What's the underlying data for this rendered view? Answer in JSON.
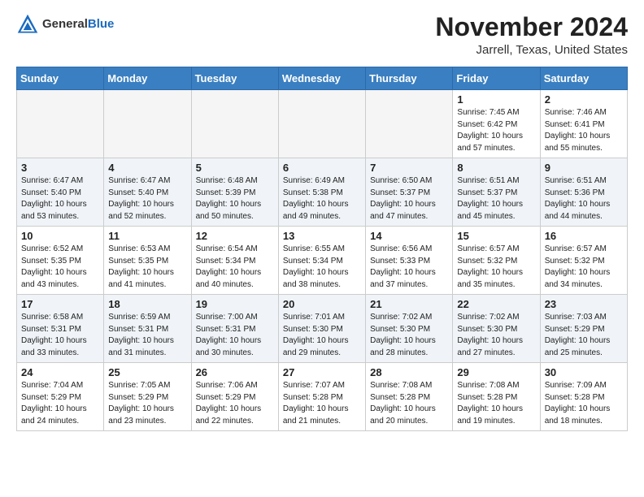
{
  "header": {
    "logo_general": "General",
    "logo_blue": "Blue",
    "month_title": "November 2024",
    "location": "Jarrell, Texas, United States"
  },
  "days_of_week": [
    "Sunday",
    "Monday",
    "Tuesday",
    "Wednesday",
    "Thursday",
    "Friday",
    "Saturday"
  ],
  "weeks": [
    [
      {
        "day": "",
        "info": ""
      },
      {
        "day": "",
        "info": ""
      },
      {
        "day": "",
        "info": ""
      },
      {
        "day": "",
        "info": ""
      },
      {
        "day": "",
        "info": ""
      },
      {
        "day": "1",
        "info": "Sunrise: 7:45 AM\nSunset: 6:42 PM\nDaylight: 10 hours\nand 57 minutes."
      },
      {
        "day": "2",
        "info": "Sunrise: 7:46 AM\nSunset: 6:41 PM\nDaylight: 10 hours\nand 55 minutes."
      }
    ],
    [
      {
        "day": "3",
        "info": "Sunrise: 6:47 AM\nSunset: 5:40 PM\nDaylight: 10 hours\nand 53 minutes."
      },
      {
        "day": "4",
        "info": "Sunrise: 6:47 AM\nSunset: 5:40 PM\nDaylight: 10 hours\nand 52 minutes."
      },
      {
        "day": "5",
        "info": "Sunrise: 6:48 AM\nSunset: 5:39 PM\nDaylight: 10 hours\nand 50 minutes."
      },
      {
        "day": "6",
        "info": "Sunrise: 6:49 AM\nSunset: 5:38 PM\nDaylight: 10 hours\nand 49 minutes."
      },
      {
        "day": "7",
        "info": "Sunrise: 6:50 AM\nSunset: 5:37 PM\nDaylight: 10 hours\nand 47 minutes."
      },
      {
        "day": "8",
        "info": "Sunrise: 6:51 AM\nSunset: 5:37 PM\nDaylight: 10 hours\nand 45 minutes."
      },
      {
        "day": "9",
        "info": "Sunrise: 6:51 AM\nSunset: 5:36 PM\nDaylight: 10 hours\nand 44 minutes."
      }
    ],
    [
      {
        "day": "10",
        "info": "Sunrise: 6:52 AM\nSunset: 5:35 PM\nDaylight: 10 hours\nand 43 minutes."
      },
      {
        "day": "11",
        "info": "Sunrise: 6:53 AM\nSunset: 5:35 PM\nDaylight: 10 hours\nand 41 minutes."
      },
      {
        "day": "12",
        "info": "Sunrise: 6:54 AM\nSunset: 5:34 PM\nDaylight: 10 hours\nand 40 minutes."
      },
      {
        "day": "13",
        "info": "Sunrise: 6:55 AM\nSunset: 5:34 PM\nDaylight: 10 hours\nand 38 minutes."
      },
      {
        "day": "14",
        "info": "Sunrise: 6:56 AM\nSunset: 5:33 PM\nDaylight: 10 hours\nand 37 minutes."
      },
      {
        "day": "15",
        "info": "Sunrise: 6:57 AM\nSunset: 5:32 PM\nDaylight: 10 hours\nand 35 minutes."
      },
      {
        "day": "16",
        "info": "Sunrise: 6:57 AM\nSunset: 5:32 PM\nDaylight: 10 hours\nand 34 minutes."
      }
    ],
    [
      {
        "day": "17",
        "info": "Sunrise: 6:58 AM\nSunset: 5:31 PM\nDaylight: 10 hours\nand 33 minutes."
      },
      {
        "day": "18",
        "info": "Sunrise: 6:59 AM\nSunset: 5:31 PM\nDaylight: 10 hours\nand 31 minutes."
      },
      {
        "day": "19",
        "info": "Sunrise: 7:00 AM\nSunset: 5:31 PM\nDaylight: 10 hours\nand 30 minutes."
      },
      {
        "day": "20",
        "info": "Sunrise: 7:01 AM\nSunset: 5:30 PM\nDaylight: 10 hours\nand 29 minutes."
      },
      {
        "day": "21",
        "info": "Sunrise: 7:02 AM\nSunset: 5:30 PM\nDaylight: 10 hours\nand 28 minutes."
      },
      {
        "day": "22",
        "info": "Sunrise: 7:02 AM\nSunset: 5:30 PM\nDaylight: 10 hours\nand 27 minutes."
      },
      {
        "day": "23",
        "info": "Sunrise: 7:03 AM\nSunset: 5:29 PM\nDaylight: 10 hours\nand 25 minutes."
      }
    ],
    [
      {
        "day": "24",
        "info": "Sunrise: 7:04 AM\nSunset: 5:29 PM\nDaylight: 10 hours\nand 24 minutes."
      },
      {
        "day": "25",
        "info": "Sunrise: 7:05 AM\nSunset: 5:29 PM\nDaylight: 10 hours\nand 23 minutes."
      },
      {
        "day": "26",
        "info": "Sunrise: 7:06 AM\nSunset: 5:29 PM\nDaylight: 10 hours\nand 22 minutes."
      },
      {
        "day": "27",
        "info": "Sunrise: 7:07 AM\nSunset: 5:28 PM\nDaylight: 10 hours\nand 21 minutes."
      },
      {
        "day": "28",
        "info": "Sunrise: 7:08 AM\nSunset: 5:28 PM\nDaylight: 10 hours\nand 20 minutes."
      },
      {
        "day": "29",
        "info": "Sunrise: 7:08 AM\nSunset: 5:28 PM\nDaylight: 10 hours\nand 19 minutes."
      },
      {
        "day": "30",
        "info": "Sunrise: 7:09 AM\nSunset: 5:28 PM\nDaylight: 10 hours\nand 18 minutes."
      }
    ]
  ]
}
